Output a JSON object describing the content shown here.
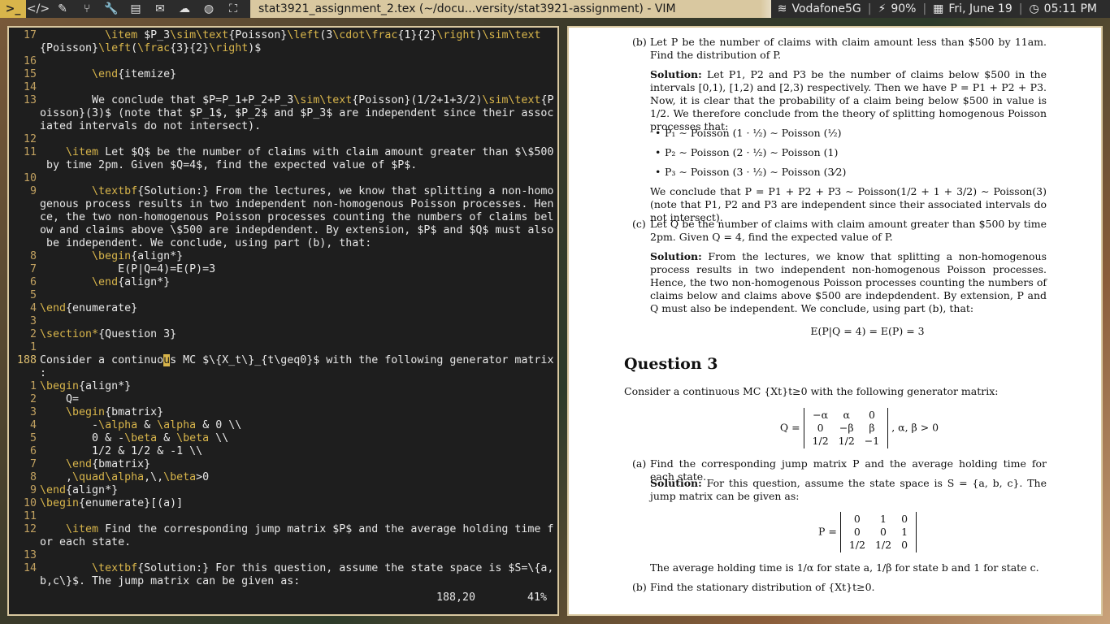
{
  "topbar": {
    "icons": [
      "terminal-icon",
      "code-icon",
      "edit-icon",
      "git-icon",
      "wrench-icon",
      "book-icon",
      "mail-icon",
      "chat-icon",
      "globe-icon",
      "fullscreen-icon"
    ],
    "window_title": "stat3921_assignment_2.tex (~/docu...versity/stat3921-assignment) - VIM",
    "wifi": "Vodafone5G",
    "battery": "90%",
    "date": "Fri, June 19",
    "time": "05:11 PM"
  },
  "vim": {
    "lines": [
      {
        "n": "17",
        "t": "          \\item $P_3\\sim\\text{Poisson}\\left(3\\cdot\\frac{1}{2}\\right)\\sim\\text"
      },
      {
        "n": "",
        "t": "{Poisson}\\left(\\frac{3}{2}\\right)$"
      },
      {
        "n": "16",
        "t": ""
      },
      {
        "n": "15",
        "t": "        \\end{itemize}"
      },
      {
        "n": "14",
        "t": ""
      },
      {
        "n": "13",
        "t": "        We conclude that $P=P_1+P_2+P_3\\sim\\text{Poisson}(1/2+1+3/2)\\sim\\text{P"
      },
      {
        "n": "",
        "t": "oisson}(3)$ (note that $P_1$, $P_2$ and $P_3$ are independent since their assoc"
      },
      {
        "n": "",
        "t": "iated intervals do not intersect)."
      },
      {
        "n": "12",
        "t": ""
      },
      {
        "n": "11",
        "t": "    \\item Let $Q$ be the number of claims with claim amount greater than $\\$500"
      },
      {
        "n": "",
        "t": " by time 2pm. Given $Q=4$, find the expected value of $P$."
      },
      {
        "n": "10",
        "t": ""
      },
      {
        "n": "9",
        "t": "        \\textbf{Solution:} From the lectures, we know that splitting a non-homo"
      },
      {
        "n": "",
        "t": "genous process results in two independent non-homogenous Poisson processes. Hen"
      },
      {
        "n": "",
        "t": "ce, the two non-homogenous Poisson processes counting the numbers of claims bel"
      },
      {
        "n": "",
        "t": "ow and claims above \\$500 are indepdendent. By extension, $P$ and $Q$ must also"
      },
      {
        "n": "",
        "t": " be independent. We conclude, using part (b), that:"
      },
      {
        "n": "8",
        "t": "        \\begin{align*}"
      },
      {
        "n": "7",
        "t": "            E(P|Q=4)=E(P)=3"
      },
      {
        "n": "6",
        "t": "        \\end{align*}"
      },
      {
        "n": "5",
        "t": ""
      },
      {
        "n": "4",
        "t": "\\end{enumerate}"
      },
      {
        "n": "3",
        "t": ""
      },
      {
        "n": "2",
        "t": "\\section*{Question 3}"
      },
      {
        "n": "1",
        "t": ""
      },
      {
        "n": "188",
        "t": "Consider a continuous MC $\\{X_t\\}_{t\\geq0}$ with the following generator matrix",
        "cur": true
      },
      {
        "n": "",
        "t": ":"
      },
      {
        "n": "1",
        "t": "\\begin{align*}"
      },
      {
        "n": "2",
        "t": "    Q="
      },
      {
        "n": "3",
        "t": "    \\begin{bmatrix}"
      },
      {
        "n": "4",
        "t": "        -\\alpha & \\alpha & 0 \\\\"
      },
      {
        "n": "5",
        "t": "        0 & -\\beta & \\beta \\\\"
      },
      {
        "n": "6",
        "t": "        1/2 & 1/2 & -1 \\\\"
      },
      {
        "n": "7",
        "t": "    \\end{bmatrix}"
      },
      {
        "n": "8",
        "t": "    ,\\quad\\alpha,\\,\\beta>0"
      },
      {
        "n": "9",
        "t": "\\end{align*}"
      },
      {
        "n": "10",
        "t": "\\begin{enumerate}[(a)]"
      },
      {
        "n": "11",
        "t": ""
      },
      {
        "n": "12",
        "t": "    \\item Find the corresponding jump matrix $P$ and the average holding time f"
      },
      {
        "n": "",
        "t": "or each state."
      },
      {
        "n": "13",
        "t": ""
      },
      {
        "n": "14",
        "t": "        \\textbf{Solution:} For this question, assume the state space is $S=\\{a,"
      },
      {
        "n": "",
        "t": "b,c\\}$. The jump matrix can be given as:"
      }
    ],
    "ruler_pos": "188,20",
    "ruler_pct": "41%"
  },
  "pdf": {
    "b_label": "(b)",
    "b_question": "Let P be the number of claims with claim amount less than $500 by 11am. Find the distribution of P.",
    "b_sol_label": "Solution:",
    "b_sol_text": " Let P1, P2 and P3 be the number of claims below $500 in the intervals [0,1), [1,2) and [2,3) respectively. Then we have P = P1 + P2 + P3. Now, it is clear that the probability of a claim being below $500 in value is 1/2. We therefore conclude from the theory of splitting homogenous Poisson processes that:",
    "bullets": [
      "P₁ ∼ Poisson (1 · ½) ∼ Poisson (½)",
      "P₂ ∼ Poisson (2 · ½) ∼ Poisson (1)",
      "P₃ ∼ Poisson (3 · ½) ∼ Poisson (3⁄2)"
    ],
    "b_conclude": "We conclude that P = P1 + P2 + P3 ∼ Poisson(1/2 + 1 + 3/2) ∼ Poisson(3) (note that P1, P2 and P3 are independent since their associated intervals do not intersect).",
    "c_label": "(c)",
    "c_question": "Let Q be the number of claims with claim amount greater than $500 by time 2pm. Given Q = 4, find the expected value of P.",
    "c_sol_label": "Solution:",
    "c_sol_text": " From the lectures, we know that splitting a non-homogenous process results in two independent non-homogenous Poisson processes. Hence, the two non-homogenous Poisson processes counting the numbers of claims below and claims above $500 are indepdendent. By extension, P and Q must also be independent. We conclude, using part (b), that:",
    "c_equation": "E(P|Q = 4) = E(P) = 3",
    "q3_heading": "Question 3",
    "q3_intro": "Consider a continuous MC {Xt}t≥0 with the following generator matrix:",
    "q_matrix_lhs": "Q =",
    "q_matrix": [
      [
        "−α",
        "α",
        "0"
      ],
      [
        "0",
        "−β",
        "β"
      ],
      [
        "1/2",
        "1/2",
        "−1"
      ]
    ],
    "q_matrix_rhs": ",    α, β > 0",
    "a_label": "(a)",
    "a_question": "Find the corresponding jump matrix P and the average holding time for each state.",
    "a_sol_label": "Solution:",
    "a_sol_text": " For this question, assume the state space is S = {a, b, c}. The jump matrix can be given as:",
    "p_matrix_lhs": "P =",
    "p_matrix": [
      [
        "0",
        "1",
        "0"
      ],
      [
        "0",
        "0",
        "1"
      ],
      [
        "1/2",
        "1/2",
        "0"
      ]
    ],
    "a_holding": "The average holding time is 1/α for state a, 1/β for state b and 1 for state c.",
    "b2_label": "(b)",
    "b2_question": "Find the stationary distribution of {Xt}t≥0."
  }
}
